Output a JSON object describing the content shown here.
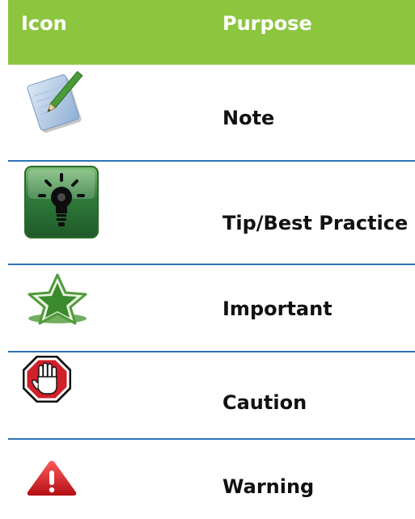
{
  "header": {
    "icon_col": "Icon",
    "purpose_col": "Purpose",
    "bg_color": "#8cc63f"
  },
  "rows": [
    {
      "label": "Note",
      "icon": "notepad-pencil-icon"
    },
    {
      "label": "Tip/Best Practice",
      "icon": "lightbulb-icon"
    },
    {
      "label": "Important",
      "icon": "star-icon"
    },
    {
      "label": "Caution",
      "icon": "stop-hand-icon"
    },
    {
      "label": "Warning",
      "icon": "warning-triangle-icon"
    }
  ],
  "colors": {
    "divider": "#2f73b7",
    "green": "#8cc63f"
  }
}
